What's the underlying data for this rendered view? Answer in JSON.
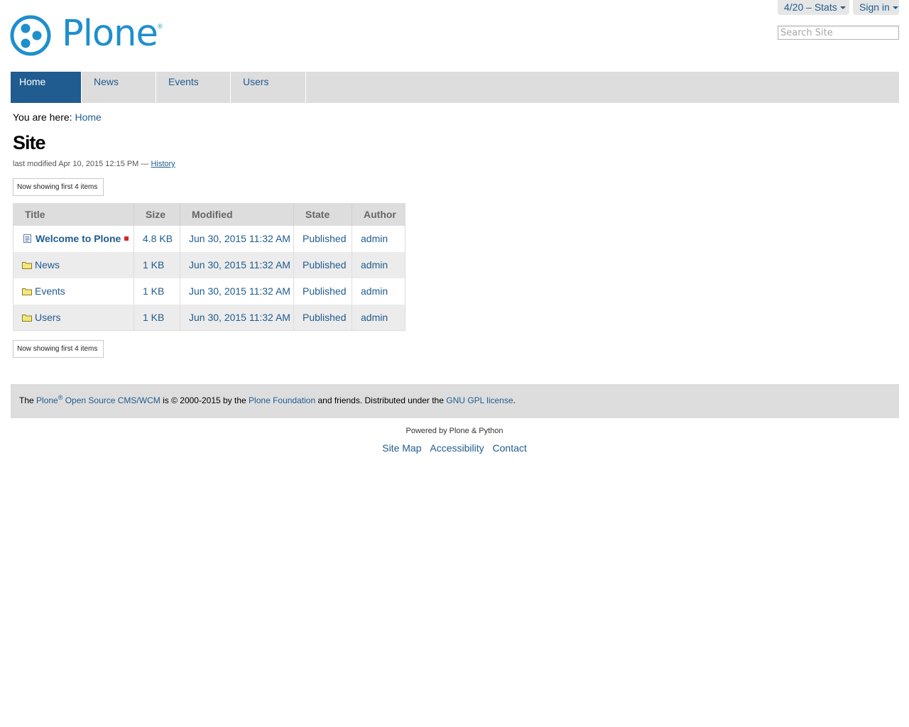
{
  "header": {
    "stats_label": "4/20 – Stats",
    "signin_label": "Sign in",
    "search_placeholder": "Search Site",
    "logo_text": "Plone",
    "logo_reg": "®"
  },
  "nav": {
    "tabs": [
      {
        "label": "Home"
      },
      {
        "label": "News"
      },
      {
        "label": "Events"
      },
      {
        "label": "Users"
      }
    ]
  },
  "breadcrumb": {
    "prefix": "You are here:",
    "home": "Home"
  },
  "page": {
    "title": "Site",
    "modified_prefix": "last modified Apr 10, 2015 12:15 PM —",
    "history_label": "History",
    "showing_label": "Now showing first 4 items"
  },
  "table": {
    "headers": [
      "Title",
      "Size",
      "Modified",
      "State",
      "Author"
    ],
    "rows": [
      {
        "title": "Welcome to Plone",
        "size": "4.8 KB",
        "modified": "Jun 30, 2015 11:32 AM",
        "state": "Published",
        "author": "admin",
        "icon": "document-icon"
      },
      {
        "title": "News",
        "size": "1 KB",
        "modified": "Jun 30, 2015 11:32 AM",
        "state": "Published",
        "author": "admin",
        "icon": "folder-icon"
      },
      {
        "title": "Events",
        "size": "1 KB",
        "modified": "Jun 30, 2015 11:32 AM",
        "state": "Published",
        "author": "admin",
        "icon": "folder-icon"
      },
      {
        "title": "Users",
        "size": "1 KB",
        "modified": "Jun 30, 2015 11:32 AM",
        "state": "Published",
        "author": "admin",
        "icon": "folder-icon"
      }
    ]
  },
  "footer": {
    "the": "The",
    "plone_link": "Plone",
    "reg": "®",
    "cms_link": "Open Source CMS/WCM",
    "copyright": "is © 2000-2015 by the",
    "foundation_link": "Plone Foundation",
    "distributed": "and friends. Distributed under the",
    "license_link": "GNU GPL license",
    "period": ".",
    "powered": "Powered by Plone & Python",
    "actions": [
      "Site Map",
      "Accessibility",
      "Contact"
    ]
  },
  "colors": {
    "accent": "#205c90",
    "logo": "#1f8fcc",
    "nav_bg": "#dddddd",
    "lock": "#d62727"
  }
}
